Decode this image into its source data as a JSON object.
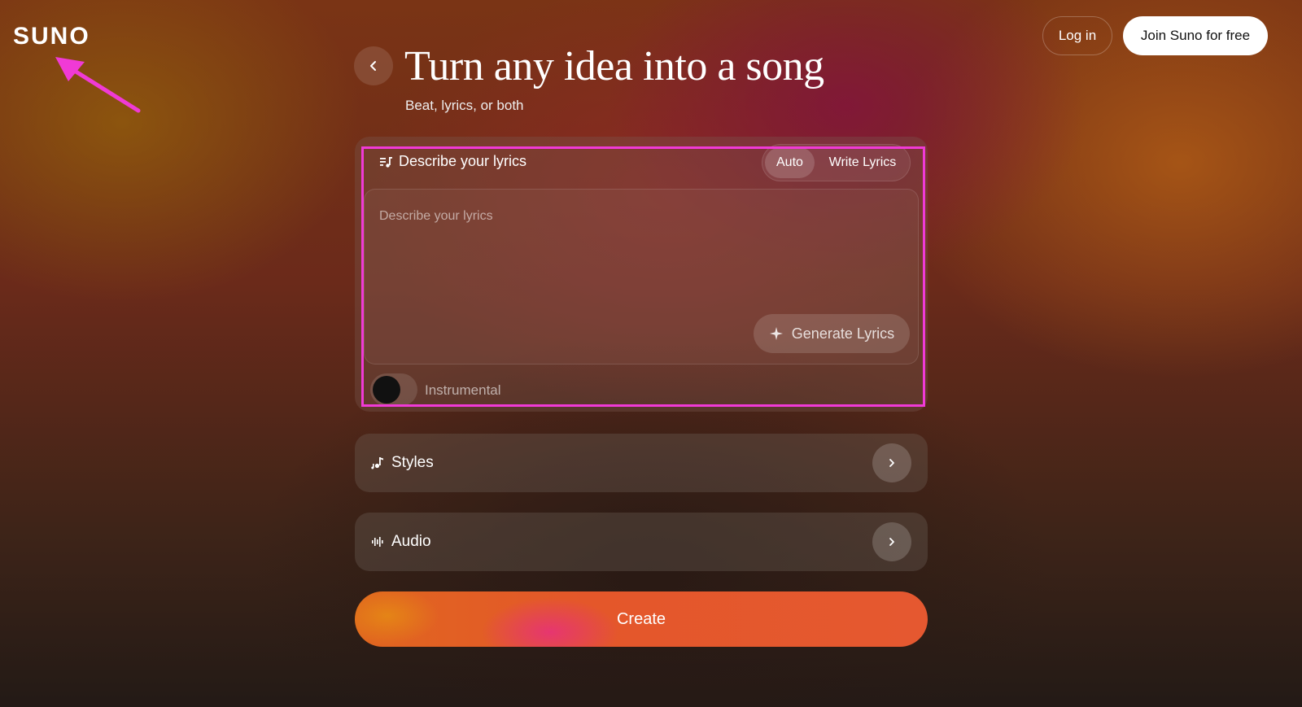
{
  "header": {
    "logo": "SUNO",
    "login_label": "Log in",
    "join_label": "Join Suno for free"
  },
  "hero": {
    "title": "Turn any idea into a song",
    "subtitle": "Beat, lyrics, or both"
  },
  "lyrics_panel": {
    "label": "Describe your lyrics",
    "modes": [
      "Auto",
      "Write Lyrics"
    ],
    "selected_mode": "Auto",
    "input_placeholder": "Describe your lyrics",
    "input_value": "",
    "generate_label": "Generate Lyrics",
    "instrumental_label": "Instrumental",
    "instrumental_on": false
  },
  "sections": {
    "styles_label": "Styles",
    "audio_label": "Audio"
  },
  "create_label": "Create",
  "colors": {
    "annotation": "#f03ad6",
    "create_button": "#e4572a"
  },
  "icons": {
    "back": "chevron-left-icon",
    "lyrics": "lyrics-music-icon",
    "generate": "sparkle-icon",
    "styles": "music-note-icon",
    "audio": "waveform-icon",
    "chevron": "chevron-right-icon"
  }
}
